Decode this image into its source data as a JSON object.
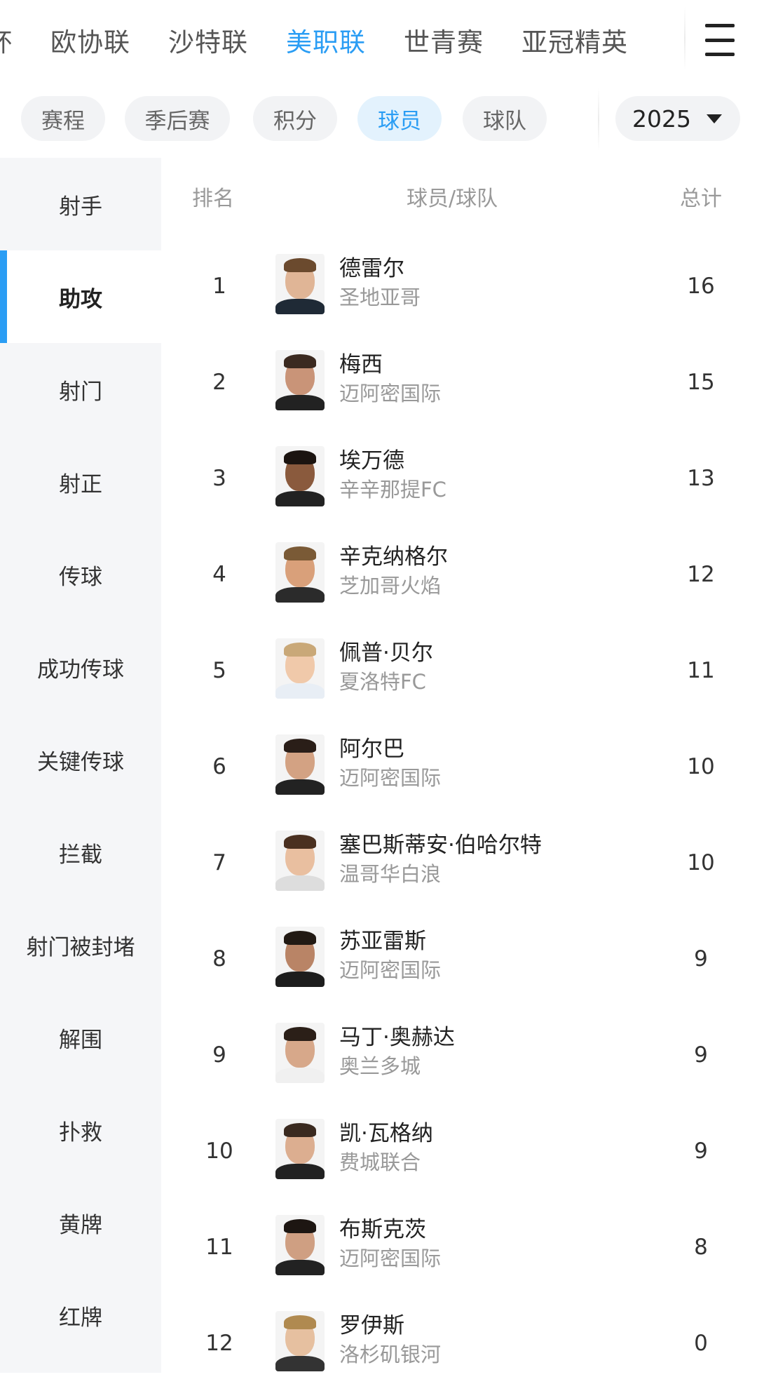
{
  "league_tabs": [
    {
      "label": "杯",
      "active": false
    },
    {
      "label": "欧协联",
      "active": false
    },
    {
      "label": "沙特联",
      "active": false
    },
    {
      "label": "美职联",
      "active": true
    },
    {
      "label": "世青赛",
      "active": false
    },
    {
      "label": "亚冠精英",
      "active": false
    }
  ],
  "menu_icon": "hamburger-menu-icon",
  "sub_tabs": [
    {
      "label": "赛程",
      "active": false
    },
    {
      "label": "季后赛",
      "active": false
    },
    {
      "label": "积分",
      "active": false
    },
    {
      "label": "球员",
      "active": true
    },
    {
      "label": "球队",
      "active": false
    }
  ],
  "season_select": {
    "value": "2025",
    "icon": "caret-down-icon"
  },
  "categories": [
    {
      "label": "射手",
      "active": false
    },
    {
      "label": "助攻",
      "active": true
    },
    {
      "label": "射门",
      "active": false
    },
    {
      "label": "射正",
      "active": false
    },
    {
      "label": "传球",
      "active": false
    },
    {
      "label": "成功传球",
      "active": false
    },
    {
      "label": "关键传球",
      "active": false
    },
    {
      "label": "拦截",
      "active": false
    },
    {
      "label": "射门被封堵",
      "active": false
    },
    {
      "label": "解围",
      "active": false
    },
    {
      "label": "扑救",
      "active": false
    },
    {
      "label": "黄牌",
      "active": false
    },
    {
      "label": "红牌",
      "active": false
    }
  ],
  "table": {
    "headers": {
      "rank": "排名",
      "player": "球员/球队",
      "total": "总计"
    },
    "rows": [
      {
        "rank": "1",
        "name": "德雷尔",
        "team": "圣地亚哥",
        "total": "16"
      },
      {
        "rank": "2",
        "name": "梅西",
        "team": "迈阿密国际",
        "total": "15"
      },
      {
        "rank": "3",
        "name": "埃万德",
        "team": "辛辛那提FC",
        "total": "13"
      },
      {
        "rank": "4",
        "name": "辛克纳格尔",
        "team": "芝加哥火焰",
        "total": "12"
      },
      {
        "rank": "5",
        "name": "佩普·贝尔",
        "team": "夏洛特FC",
        "total": "11"
      },
      {
        "rank": "6",
        "name": "阿尔巴",
        "team": "迈阿密国际",
        "total": "10"
      },
      {
        "rank": "7",
        "name": "塞巴斯蒂安·伯哈尔特",
        "team": "温哥华白浪",
        "total": "10"
      },
      {
        "rank": "8",
        "name": "苏亚雷斯",
        "team": "迈阿密国际",
        "total": "9"
      },
      {
        "rank": "9",
        "name": "马丁·奥赫达",
        "team": "奥兰多城",
        "total": "9"
      },
      {
        "rank": "10",
        "name": "凯·瓦格纳",
        "team": "费城联合",
        "total": "9"
      },
      {
        "rank": "11",
        "name": "布斯克茨",
        "team": "迈阿密国际",
        "total": "8"
      },
      {
        "rank": "12",
        "name": "罗伊斯",
        "team": "洛杉矶银河",
        "total": "0"
      }
    ]
  },
  "colors": {
    "accent": "#2a9df4",
    "sidebar_bg": "#f5f6f8",
    "muted_text": "#999999"
  }
}
